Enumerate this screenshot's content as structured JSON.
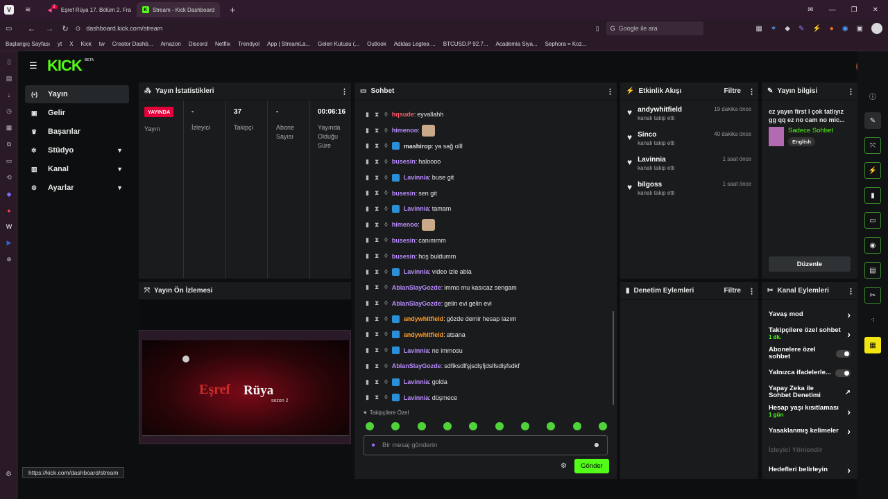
{
  "browser": {
    "tabs": [
      {
        "label": "Eşref Rüya 17. Bölüm 2. Fra",
        "badge": "2"
      },
      {
        "label": "Stream - Kick Dashboard"
      }
    ],
    "url": "dashboard.kick.com/stream",
    "search_placeholder": "Google ile ara",
    "bookmarks": [
      "Başlangıç Sayfası",
      "yt",
      "X",
      "Kick",
      "tw",
      "Creator Dashb...",
      "Amazon",
      "Discord",
      "Netflix",
      "Trendyol",
      "App | StreamLa...",
      "Gelen Kutusu (...",
      "Outlook",
      "Adidas Legtea ...",
      "BTCUSD.P 92.7...",
      "Academia Siya...",
      "Sephora = Koz..."
    ],
    "status_url": "https://kick.com/dashboard/stream"
  },
  "logo": "KICK",
  "logo_beta": "BETA",
  "nav": [
    {
      "label": "Yayın",
      "icon": "broadcast-icon"
    },
    {
      "label": "Gelir",
      "icon": "revenue-icon"
    },
    {
      "label": "Başarılar",
      "icon": "trophy-icon"
    },
    {
      "label": "Stüdyo",
      "icon": "studio-icon"
    },
    {
      "label": "Kanal",
      "icon": "channel-icon"
    },
    {
      "label": "Ayarlar",
      "icon": "settings-icon"
    }
  ],
  "stats": {
    "title": "Yayın İstatistikleri",
    "live_badge": "YAYINDA",
    "live_label": "Yayın",
    "items": [
      {
        "value": "-",
        "label": "İzleyici"
      },
      {
        "value": "37",
        "label": "Takipçi"
      },
      {
        "value": "-",
        "label": "Abone Sayısı"
      },
      {
        "value": "00:06:16",
        "label": "Yayında Olduğu Süre"
      }
    ]
  },
  "preview": {
    "title": "Yayın Ön İzlemesi",
    "video_title": "Eşref",
    "video_title2": "Rüya",
    "video_sub": "sezon 2"
  },
  "chat": {
    "title": "Sohbet",
    "messages": [
      {
        "user": "hqsude",
        "color": "#ff5a6a",
        "text": "eyvallahh",
        "badge": false,
        "emote": false
      },
      {
        "user": "himenoo",
        "color": "#b98cff",
        "text": "",
        "badge": false,
        "emote": true
      },
      {
        "user": "mashirop",
        "color": "#e0e0e0",
        "text": "ya sağ olll",
        "badge": true,
        "emote": false
      },
      {
        "user": "busesin",
        "color": "#b98cff",
        "text": "haloooo",
        "badge": false,
        "emote": false
      },
      {
        "user": "Lavinnia",
        "color": "#b98cff",
        "text": "buse git",
        "badge": true,
        "emote": false
      },
      {
        "user": "busesin",
        "color": "#b98cff",
        "text": "sen git",
        "badge": false,
        "emote": false
      },
      {
        "user": "Lavinnia",
        "color": "#b98cff",
        "text": "tamam",
        "badge": true,
        "emote": false
      },
      {
        "user": "himenoo",
        "color": "#b98cff",
        "text": "",
        "badge": false,
        "emote": true
      },
      {
        "user": "busesin",
        "color": "#b98cff",
        "text": "canımmm",
        "badge": false,
        "emote": false
      },
      {
        "user": "busesin",
        "color": "#b98cff",
        "text": "hoş buldumm",
        "badge": false,
        "emote": false
      },
      {
        "user": "Lavinnia",
        "color": "#b98cff",
        "text": "video izle abla",
        "badge": true,
        "emote": false
      },
      {
        "user": "AblanSlayGozde",
        "color": "#b98cff",
        "text": "immo mu kasıcaz sengam",
        "badge": false,
        "emote": false
      },
      {
        "user": "AblanSlayGozde",
        "color": "#b98cff",
        "text": "gelin evi gelin evi",
        "badge": false,
        "emote": false
      },
      {
        "user": "andywhitfield",
        "color": "#ff9e2c",
        "text": "gözde demir hesap lazım",
        "badge": true,
        "emote": false
      },
      {
        "user": "andywhitfield",
        "color": "#ff9e2c",
        "text": "atsana",
        "badge": true,
        "emote": false
      },
      {
        "user": "Lavinnia",
        "color": "#b98cff",
        "text": "ne immosu",
        "badge": true,
        "emote": false
      },
      {
        "user": "AblanSlayGozde",
        "color": "#b98cff",
        "text": "sdfiksdlfşjsdlşfjdslfsdlşfsdkf",
        "badge": false,
        "emote": false
      },
      {
        "user": "Lavinnia",
        "color": "#b98cff",
        "text": "golda",
        "badge": true,
        "emote": false
      },
      {
        "user": "Lavinnia",
        "color": "#b98cff",
        "text": "düşmece",
        "badge": true,
        "emote": false
      }
    ],
    "followers_only": "Takipçilere Özel",
    "input_placeholder": "Bir mesaj gönderin",
    "send_label": "Gönder"
  },
  "activity": {
    "title": "Etkinlik Akışı",
    "filter": "Filtre",
    "items": [
      {
        "name": "andywhitfield",
        "sub": "kanalı takip etti",
        "time": "19 dakika önce"
      },
      {
        "name": "Sinco",
        "sub": "kanalı takip etti",
        "time": "40 dakika önce"
      },
      {
        "name": "Lavinnia",
        "sub": "kanalı takip etti",
        "time": "1 saat önce"
      },
      {
        "name": "bilgoss",
        "sub": "kanalı takip etti",
        "time": "1 saat önce"
      }
    ]
  },
  "moderation": {
    "title": "Denetim Eylemleri",
    "filter": "Filtre"
  },
  "streaminfo": {
    "title": "Yayın bilgisi",
    "stream_title": "ez yayın first I çok tatlıyız gg qq ez no cam no mic...",
    "category": "Sadece Sohbet",
    "language": "English",
    "edit_label": "Düzenle"
  },
  "channel_actions": {
    "title": "Kanal Eylemleri",
    "items": [
      {
        "label": "Yavaş mod",
        "sub": "",
        "control": "chevron"
      },
      {
        "label": "Takipçilere özel sohbet",
        "sub": "1 dk.",
        "control": "chevron"
      },
      {
        "label": "Abonelere özel sohbet",
        "sub": "",
        "control": "toggle"
      },
      {
        "label": "Yalnızca ifadelerle...",
        "sub": "",
        "control": "toggle"
      },
      {
        "label": "Yapay Zeka ile Sohbet Denetimi",
        "sub": "",
        "control": "chart"
      },
      {
        "label": "Hesap yaşı kısıtlaması",
        "sub": "1 gün",
        "control": "chevron"
      },
      {
        "label": "Yasaklanmış kelimeler",
        "sub": "",
        "control": "chevron"
      },
      {
        "label": "İzleyici Yönlendir",
        "sub": "",
        "control": "none",
        "disabled": true
      },
      {
        "label": "Hedefleri belirleyin",
        "sub": "",
        "control": "chevron"
      }
    ]
  },
  "colors": {
    "accent": "#53fc18",
    "live": "#e4003b"
  }
}
